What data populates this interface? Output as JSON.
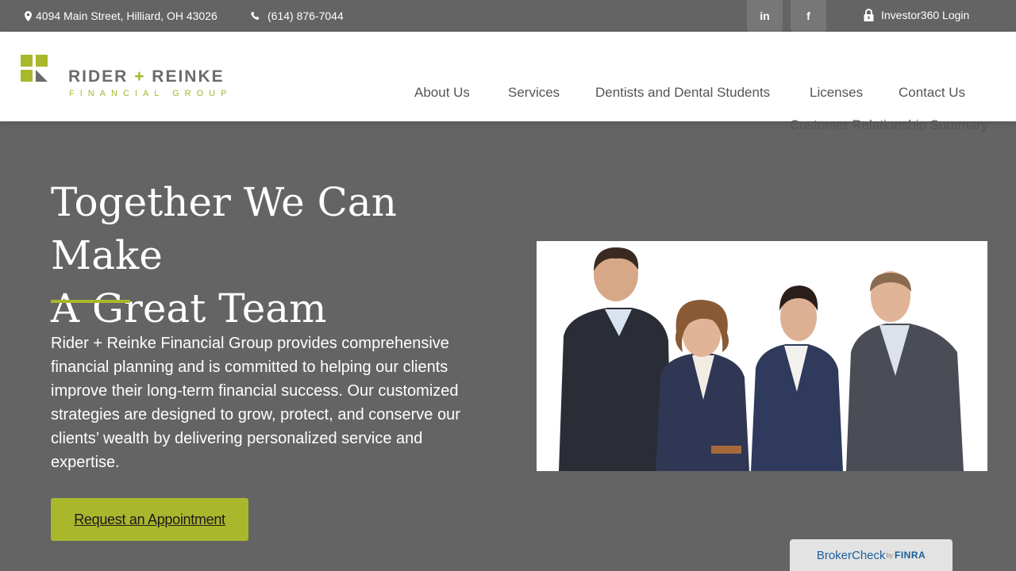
{
  "topbar": {
    "address": "4094 Main Street, Hilliard, OH 43026",
    "phone": "(614) 876-7044",
    "linkedin_label": "in",
    "facebook_label": "f",
    "login_label": "Investor360 Login"
  },
  "logo": {
    "name_left": "RIDER",
    "plus": "+",
    "name_right": "REINKE",
    "subtitle": "FINANCIAL GROUP"
  },
  "nav": {
    "items": [
      {
        "label": "About Us"
      },
      {
        "label": "Services"
      },
      {
        "label": "Dentists and Dental Students"
      },
      {
        "label": "Licenses"
      },
      {
        "label": "Contact Us"
      },
      {
        "label": "Customer Relationship Summary"
      }
    ]
  },
  "hero": {
    "title_line1": "Together We Can Make",
    "title_line2": "A Great Team",
    "body": "Rider + Reinke Financial Group provides comprehensive financial planning and is committed to helping our clients improve their long-term financial success. Our customized strategies are designed to grow, protect, and conserve our clients’ wealth by delivering personalized service and expertise.",
    "cta_label": "Request an Appointment"
  },
  "broker": {
    "brand": "BrokerCheck",
    "by": "by",
    "finra": "FINRA"
  },
  "colors": {
    "accent": "#a9b72d",
    "background": "#646464",
    "header": "#ffffff"
  },
  "icons": {
    "address": "map-marker-icon",
    "phone": "phone-icon",
    "login": "lock-icon"
  }
}
